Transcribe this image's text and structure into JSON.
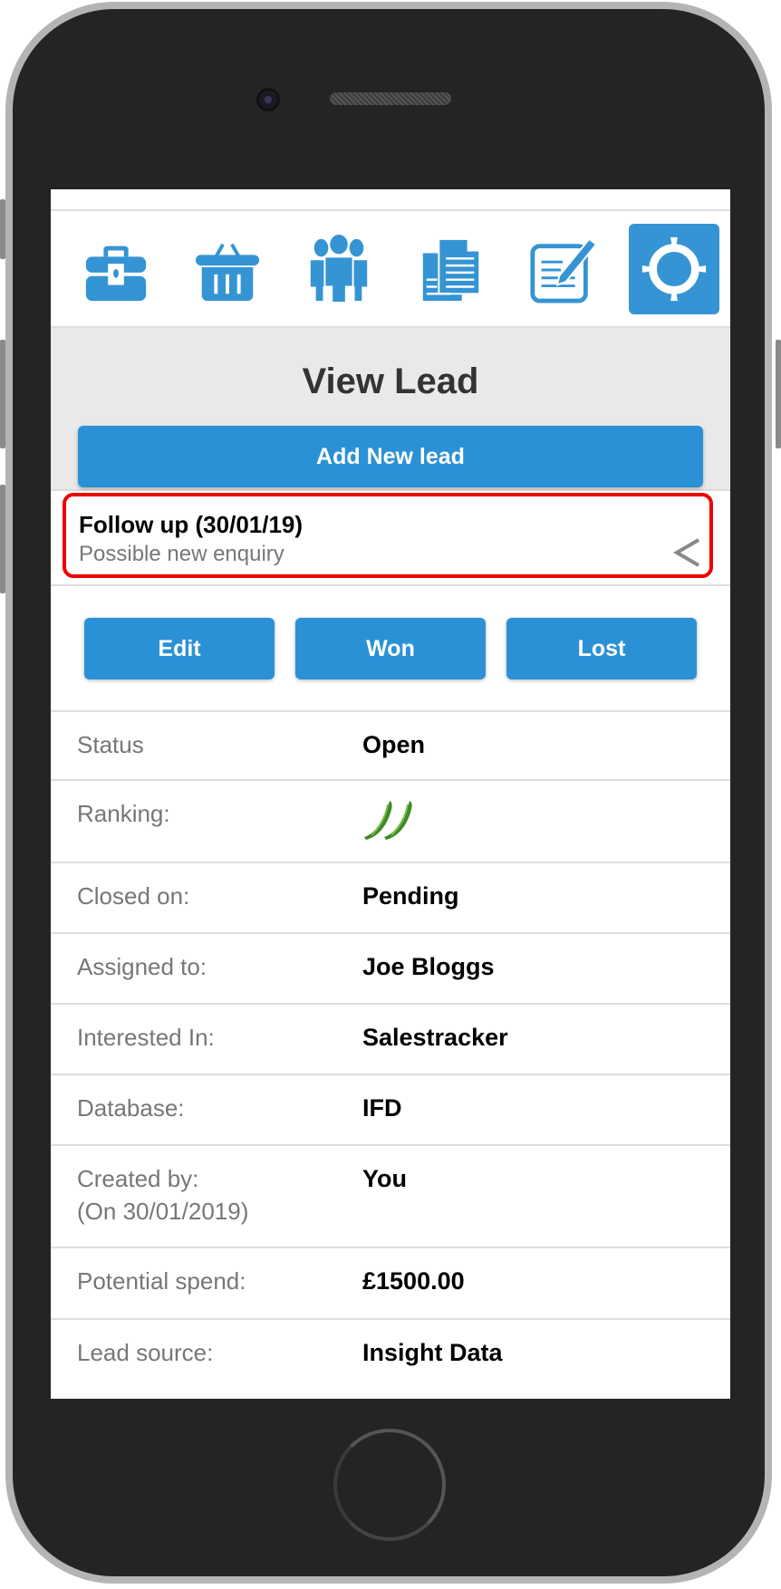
{
  "nav_icons": [
    {
      "name": "briefcase-icon",
      "active": false
    },
    {
      "name": "basket-icon",
      "active": false
    },
    {
      "name": "team-icon",
      "active": false
    },
    {
      "name": "documents-icon",
      "active": false
    },
    {
      "name": "edit-note-icon",
      "active": false
    },
    {
      "name": "target-icon",
      "active": true
    }
  ],
  "header": {
    "title": "View Lead",
    "add_button": "Add New lead"
  },
  "followup": {
    "title": "Follow up (30/01/19)",
    "subtitle": "Possible new enquiry"
  },
  "actions": {
    "edit": "Edit",
    "won": "Won",
    "lost": "Lost"
  },
  "details": [
    {
      "label": "Status",
      "value": "Open"
    },
    {
      "label": "Ranking:",
      "value": "",
      "icon": "chili-icon",
      "count": 2
    },
    {
      "label": "Closed on:",
      "value": "Pending"
    },
    {
      "label": "Assigned to:",
      "value": "Joe Bloggs"
    },
    {
      "label": "Interested In:",
      "value": "Salestracker"
    },
    {
      "label": "Database:",
      "value": "IFD"
    },
    {
      "label": "Created by:",
      "label2": "(On 30/01/2019)",
      "value": "You"
    },
    {
      "label": "Potential spend:",
      "value": "£1500.00"
    },
    {
      "label": "Lead source:",
      "value": "Insight Data"
    }
  ],
  "colors": {
    "accent": "#2b91d6",
    "icon": "#3594d3",
    "highlight_border": "#ee0000"
  }
}
